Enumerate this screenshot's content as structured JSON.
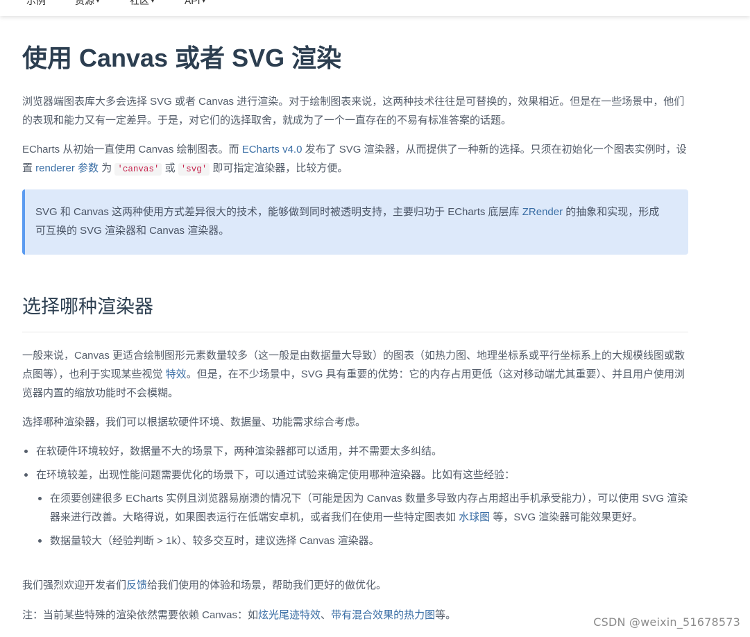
{
  "nav": {
    "items": [
      {
        "label": "示例"
      },
      {
        "label": "资源"
      },
      {
        "label": "社区"
      },
      {
        "label": "API"
      }
    ],
    "caret": "▾"
  },
  "page_title": "使用 Canvas 或者 SVG 渲染",
  "intro": {
    "p1": "浏览器端图表库大多会选择 SVG 或者 Canvas 进行渲染。对于绘制图表来说，这两种技术往往是可替换的，效果相近。但是在一些场景中，他们的表现和能力又有一定差异。于是，对它们的选择取舍，就成为了一个一直存在的不易有标准答案的话题。",
    "p2_a": "ECharts 从初始一直使用 Canvas 绘制图表。而 ",
    "p2_link1": "ECharts v4.0",
    "p2_b": " 发布了 SVG 渲染器，从而提供了一种新的选择。只须在初始化一个图表实例时，设置 ",
    "p2_link2": "renderer 参数",
    "p2_c": " 为 ",
    "p2_code1": "'canvas'",
    "p2_d": " 或 ",
    "p2_code2": "'svg'",
    "p2_e": " 即可指定渲染器，比较方便。"
  },
  "tip": {
    "a": "SVG 和 Canvas 这两种使用方式差异很大的技术，能够做到同时被透明支持，主要归功于 ECharts 底层库 ",
    "link": "ZRender",
    "b": " 的抽象和实现，形成可互换的 SVG 渲染器和 Canvas 渲染器。"
  },
  "section": {
    "title": "选择哪种渲染器",
    "p1_a": "一般来说，Canvas 更适合绘制图形元素数量较多（这一般是由数据量大导致）的图表（如热力图、地理坐标系或平行坐标系上的大规模线图或散点图等），也利于实现某些视觉 ",
    "p1_link": "特效",
    "p1_b": "。但是，在不少场景中，SVG 具有重要的优势：它的内存占用更低（这对移动端尤其重要）、并且用户使用浏览器内置的缩放功能时不会模糊。",
    "p2": "选择哪种渲染器，我们可以根据软硬件环境、数据量、功能需求综合考虑。",
    "bullet1": "在软硬件环境较好，数据量不大的场景下，两种渲染器都可以适用，并不需要太多纠结。",
    "bullet2": "在环境较差，出现性能问题需要优化的场景下，可以通过试验来确定使用哪种渲染器。比如有这些经验：",
    "sub1_a": "在须要创建很多 ECharts 实例且浏览器易崩溃的情况下（可能是因为 Canvas 数量多导致内存占用超出手机承受能力），可以使用 SVG 渲染器来进行改善。大略得说，如果图表运行在低端安卓机，或者我们在使用一些特定图表如 ",
    "sub1_link": "水球图",
    "sub1_b": " 等，SVG 渲染器可能效果更好。",
    "sub2": "数据量较大（经验判断 > 1k）、较多交互时，建议选择 Canvas 渲染器。",
    "p3_a": "我们强烈欢迎开发者们",
    "p3_link": "反馈",
    "p3_b": "给我们使用的体验和场景，帮助我们更好的做优化。",
    "p4_a": "注：当前某些特殊的渲染依然需要依赖 Canvas：如",
    "p4_link1": "炫光尾迹特效",
    "p4_sep": "、",
    "p4_link2": "带有混合效果的热力图",
    "p4_b": "等。"
  },
  "watermark": "CSDN @weixin_51678573",
  "colors": {
    "link": "#3a6ea5",
    "tip_bg": "#dde9fa",
    "tip_border": "#5b9bf0",
    "heading": "#2c3e50"
  }
}
